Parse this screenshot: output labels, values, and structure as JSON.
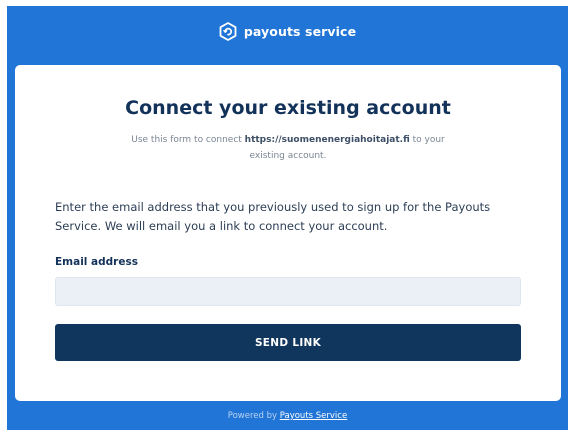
{
  "header": {
    "brand": "payouts service",
    "logo_icon": "payouts-logo-icon"
  },
  "colors": {
    "brand_blue": "#2175d6",
    "title_navy": "#13325a",
    "button_navy": "#11365d",
    "input_bg": "#ebf0f7"
  },
  "card": {
    "title": "Connect your existing account",
    "subtitle_prefix": "Use this form to connect ",
    "subtitle_site": "https://suomenenergiahoitajat.fi",
    "subtitle_suffix": " to your existing account.",
    "intro": "Enter the email address that you previously used to sign up for the Payouts Service. We will email you a link to connect your account.",
    "email_label": "Email address",
    "email_value": "",
    "email_placeholder": "",
    "send_button": "SEND LINK"
  },
  "footer": {
    "powered_by": "Powered by",
    "link": "Payouts Service"
  }
}
